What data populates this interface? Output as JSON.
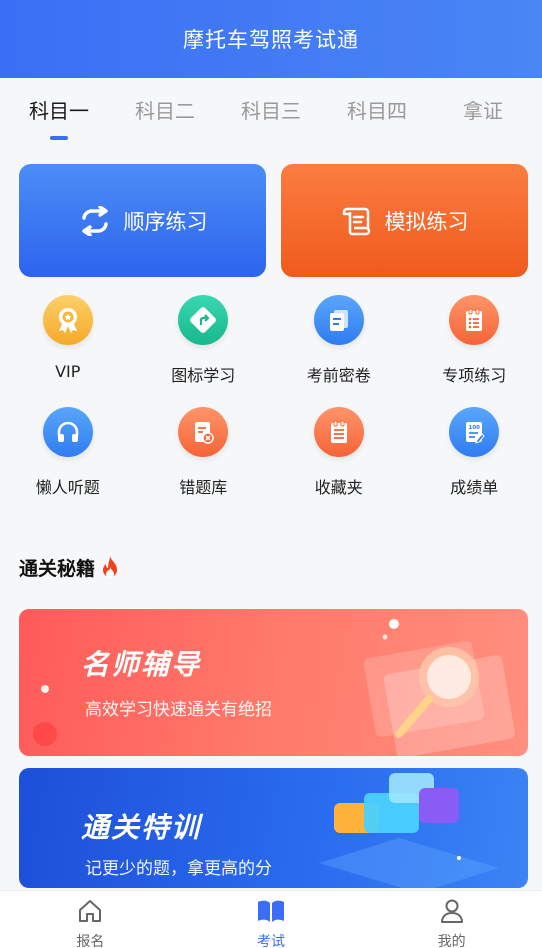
{
  "header": {
    "title": "摩托车驾照考试通"
  },
  "tabs": [
    {
      "label": "科目一",
      "active": true
    },
    {
      "label": "科目二",
      "active": false
    },
    {
      "label": "科目三",
      "active": false
    },
    {
      "label": "科目四",
      "active": false
    },
    {
      "label": "拿证",
      "active": false
    }
  ],
  "practice": {
    "sequential": {
      "label": "顺序练习",
      "icon": "repeat-icon"
    },
    "mock": {
      "label": "模拟练习",
      "icon": "exam-paper-icon"
    }
  },
  "features": [
    {
      "label": "VIP",
      "icon": "vip-badge-icon",
      "color": "#f8b43c"
    },
    {
      "label": "图标学习",
      "icon": "road-sign-icon",
      "color": "#22c59d"
    },
    {
      "label": "考前密卷",
      "icon": "document-icon",
      "color": "#3e8ef5"
    },
    {
      "label": "专项练习",
      "icon": "checklist-icon",
      "color": "#fb7a4b"
    },
    {
      "label": "懒人听题",
      "icon": "headphones-icon",
      "color": "#3e8ef5"
    },
    {
      "label": "错题库",
      "icon": "wrong-answer-icon",
      "color": "#fb7a4b"
    },
    {
      "label": "收藏夹",
      "icon": "favorites-icon",
      "color": "#fb7a4b"
    },
    {
      "label": "成绩单",
      "icon": "score-sheet-icon",
      "color": "#3e8ef5"
    }
  ],
  "section": {
    "title": "通关秘籍",
    "icon": "fire-icon"
  },
  "banners": [
    {
      "title": "名师辅导",
      "subtitle": "高效学习快速通关有绝招"
    },
    {
      "title": "通关特训",
      "subtitle": "记更少的题，拿更高的分"
    }
  ],
  "bottom_nav": [
    {
      "label": "报名",
      "icon": "home-icon",
      "active": false
    },
    {
      "label": "考试",
      "icon": "book-icon",
      "active": true
    },
    {
      "label": "我的",
      "icon": "user-icon",
      "active": false
    }
  ],
  "colors": {
    "primary": "#3a6ff5",
    "orange": "#f05a1d"
  }
}
